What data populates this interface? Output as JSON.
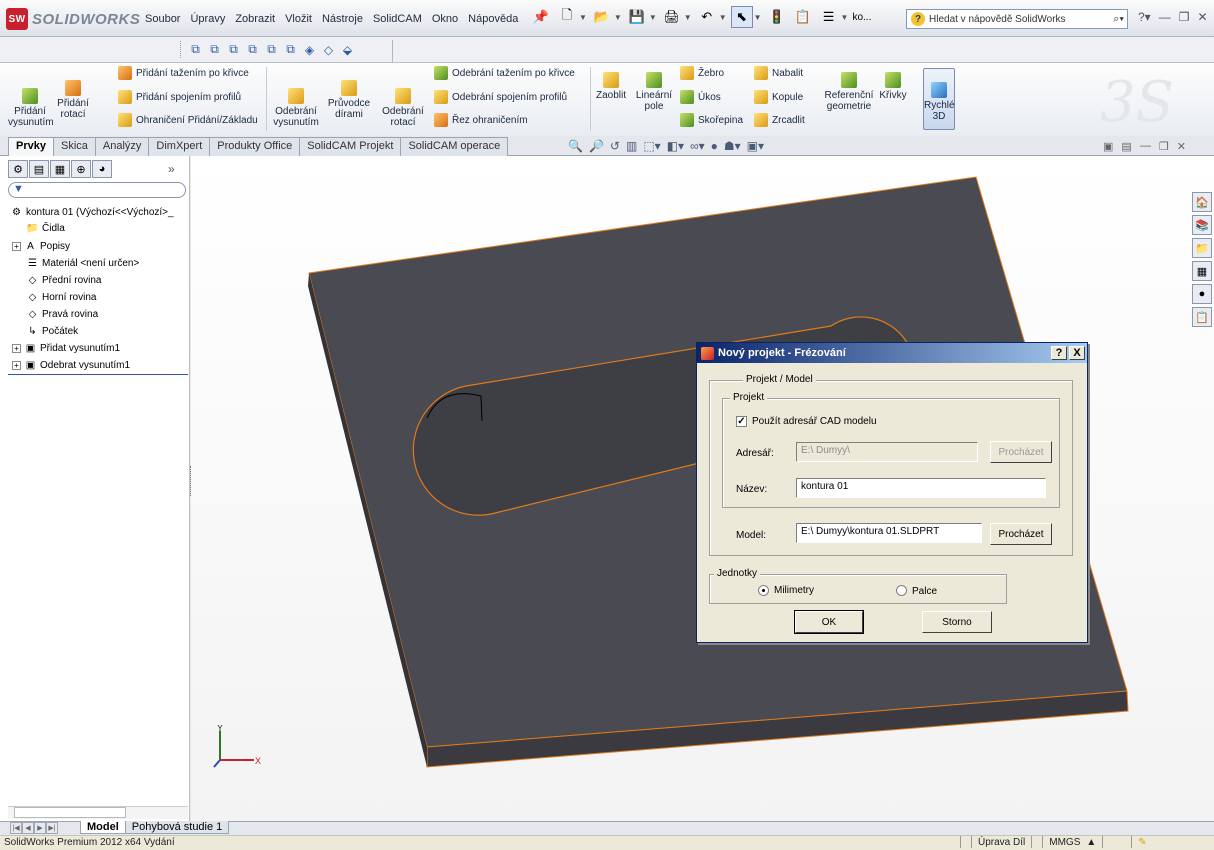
{
  "app": {
    "logo_text": "SOLIDWORKS",
    "menu": [
      "Soubor",
      "Úpravy",
      "Zobrazit",
      "Vložit",
      "Nástroje",
      "SolidCAM",
      "Okno",
      "Nápověda"
    ],
    "toolbar_overflow": "ko...",
    "help_search_placeholder": "Hledat v nápovědě SolidWorks",
    "accent_color": "#c8202f"
  },
  "command_manager": {
    "extrude_boss": "Přidání vysunutím",
    "revolve_boss": "Přidání rotací",
    "swept_boss": "Přidání tažením po křivce",
    "lofted_boss": "Přidání spojením profilů",
    "boundary_boss": "Ohraničení Přidání/Základu",
    "extrude_cut": "Odebrání vysunutím",
    "hole_wizard": "Průvodce dírami",
    "revolve_cut": "Odebrání rotací",
    "swept_cut": "Odebrání tažením po křivce",
    "lofted_cut": "Odebrání spojením profilů",
    "boundary_cut": "Řez ohraničením",
    "fillet": "Zaoblit",
    "linear_pattern": "Lineární pole",
    "rib": "Žebro",
    "draft": "Úkos",
    "shell": "Skořepina",
    "wrap": "Nabalit",
    "dome": "Kopule",
    "mirror": "Zrcadlit",
    "ref_geometry": "Referenční geometrie",
    "curves": "Křivky",
    "instant3d": "Rychlé 3D"
  },
  "tabs": [
    "Prvky",
    "Skica",
    "Analýzy",
    "DimXpert",
    "Produkty Office",
    "SolidCAM Projekt",
    "SolidCAM operace"
  ],
  "tabs_active_index": 0,
  "tree": {
    "root": "kontura 01  (Výchozí<<Výchozí>_",
    "items": [
      "Čidla",
      "Popisy",
      "Materiál <není určen>",
      "Přední rovina",
      "Horní rovina",
      "Pravá rovina",
      "Počátek",
      "Přidat vysunutím1",
      "Odebrat vysunutím1"
    ]
  },
  "triad": {
    "y": "Y",
    "x": "X"
  },
  "dialog": {
    "title": "Nový projekt - Frézování",
    "help_btn": "?",
    "close_btn": "X",
    "group_main": "Projekt / Model",
    "group_project": "Projekt",
    "use_cad_dir_label": "Použít adresář CAD modelu",
    "use_cad_dir_checked": true,
    "dir_label": "Adresář:",
    "dir_value": "E:\\ Dumyy\\",
    "dir_browse": "Procházet",
    "name_label": "Název:",
    "name_value": "kontura 01",
    "model_label": "Model:",
    "model_value": "E:\\ Dumyy\\kontura 01.SLDPRT",
    "model_browse": "Procházet",
    "units_label": "Jednotky",
    "units_mm": "Milimetry",
    "units_in": "Palce",
    "units_selected": "Milimetry",
    "ok": "OK",
    "cancel": "Storno"
  },
  "bottom_tabs": [
    "Model",
    "Pohybová studie 1"
  ],
  "bottom_tabs_active_index": 0,
  "status": {
    "left": "SolidWorks Premium 2012 x64 Vydání",
    "mode": "Úprava Díl",
    "units": "MMGS",
    "units_arrow": "▲"
  }
}
